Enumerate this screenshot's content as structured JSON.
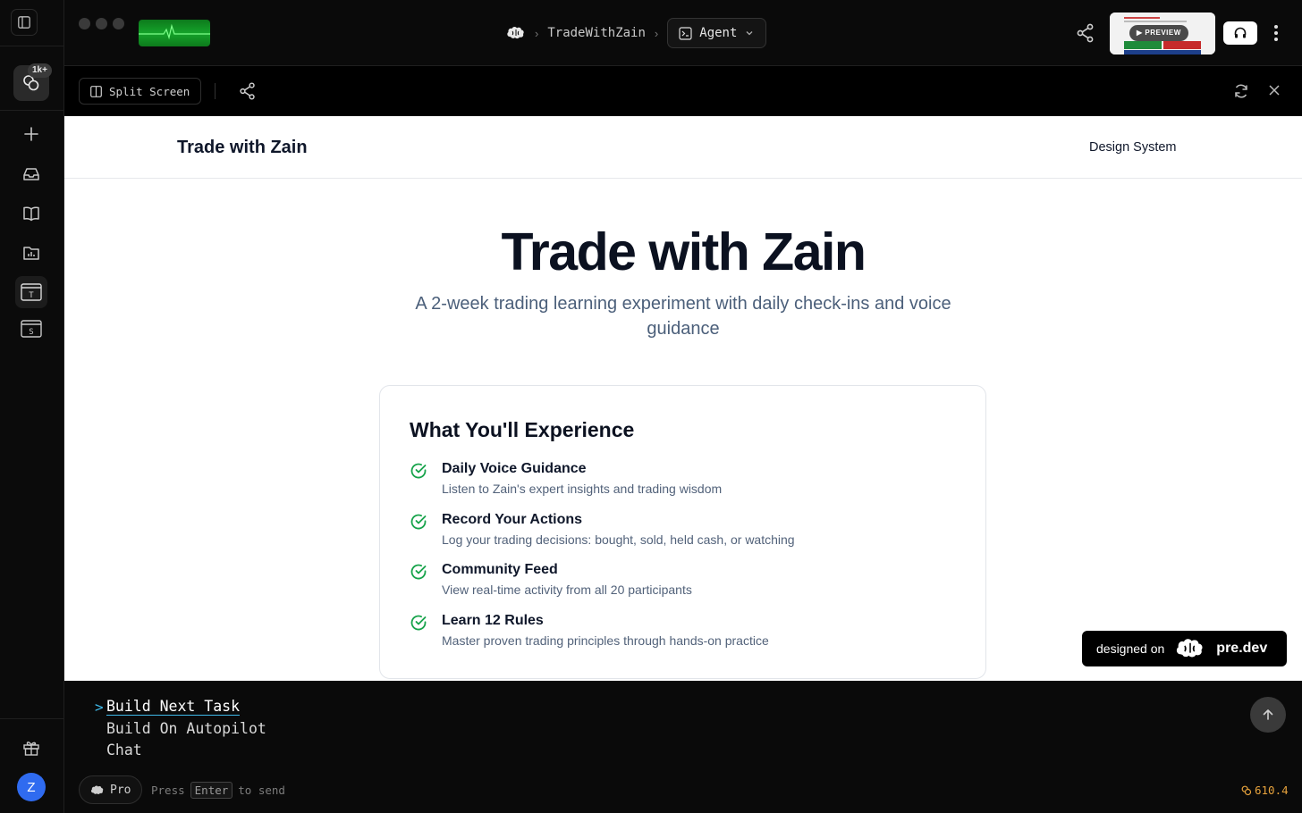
{
  "sidebar": {
    "credits_badge": "1k+",
    "items": [
      {
        "icon": "plus-icon"
      },
      {
        "icon": "inbox-icon"
      },
      {
        "icon": "book-icon"
      },
      {
        "icon": "folder-chart-icon"
      },
      {
        "icon": "window-t-icon",
        "letter": "T"
      },
      {
        "icon": "window-s-icon",
        "letter": "S"
      }
    ],
    "avatar_initial": "Z"
  },
  "topbar": {
    "project": "TradeWithZain",
    "mode": "Agent",
    "preview_label": "PREVIEW"
  },
  "preview_toolbar": {
    "split_label": "Split Screen"
  },
  "site": {
    "brand": "Trade with Zain",
    "nav_link": "Design System",
    "hero_title": "Trade with Zain",
    "hero_subtitle": "A 2-week trading learning experiment with daily check-ins and voice guidance",
    "card_title": "What You'll Experience",
    "features": [
      {
        "name": "Daily Voice Guidance",
        "desc": "Listen to Zain's expert insights and trading wisdom"
      },
      {
        "name": "Record Your Actions",
        "desc": "Log your trading decisions: bought, sold, held cash, or watching"
      },
      {
        "name": "Community Feed",
        "desc": "View real-time activity from all 20 participants"
      },
      {
        "name": "Learn 12 Rules",
        "desc": "Master proven trading principles through hands-on practice"
      }
    ],
    "designed_on": "designed on",
    "designed_brand": "pre.dev"
  },
  "composer": {
    "options": [
      "Build Next Task",
      "Build On Autopilot",
      "Chat"
    ],
    "caret": ">",
    "plan": "Pro",
    "hint_press": "Press",
    "hint_key": "Enter",
    "hint_rest": "to send",
    "credits": "610.4"
  },
  "colors": {
    "accent_check": "#16a34a",
    "cursor_accent": "#3fb9e8",
    "credit_accent": "#e6a23c",
    "avatar": "#2f6bf0"
  }
}
